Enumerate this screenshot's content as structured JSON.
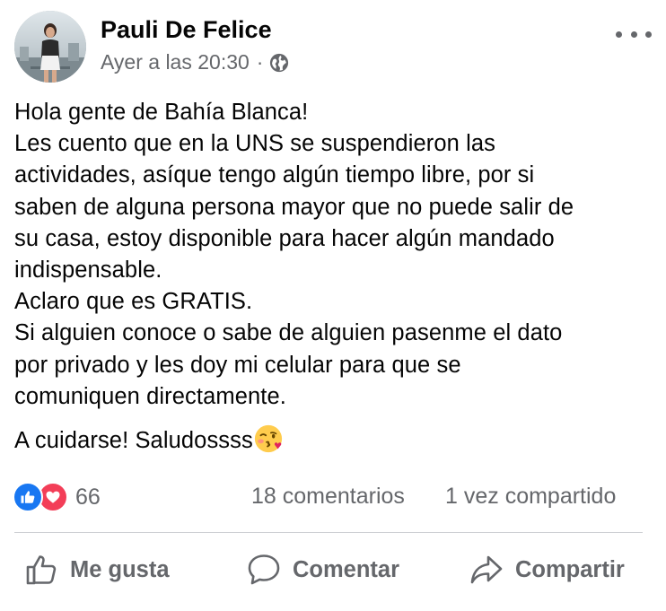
{
  "post": {
    "author": "Pauli De Felice",
    "timestamp": "Ayer a las 20:30",
    "separator": "·",
    "privacy_icon": "globe-icon",
    "more_icon": "more-horizontal-icon",
    "body_lines": [
      "Hola gente de Bahía Blanca!",
      "Les cuento que en la UNS se suspendieron las",
      "actividades, asíque tengo algún tiempo libre, por si",
      "saben de alguna persona mayor que no puede salir de",
      "su casa, estoy disponible para hacer algún mandado",
      "indispensable.",
      "Aclaro que es GRATIS.",
      "Si alguien conoce o sabe de alguien pasenme el dato",
      "por privado y les doy mi celular para que se",
      "comuniquen directamente."
    ],
    "closing": "A cuidarse! Saludossss",
    "closing_emoji": "face-blowing-kiss-emoji"
  },
  "stats": {
    "reaction_icons": [
      "like-reaction-icon",
      "love-reaction-icon"
    ],
    "reactions_count": "66",
    "comments": "18 comentarios",
    "shares": "1 vez compartido"
  },
  "actions": {
    "like_label": "Me gusta",
    "comment_label": "Comentar",
    "share_label": "Compartir"
  },
  "colors": {
    "text_primary": "#050505",
    "text_secondary": "#65676b",
    "like_blue": "#1877f2",
    "love_red": "#f33e58",
    "divider": "#ced0d4"
  }
}
